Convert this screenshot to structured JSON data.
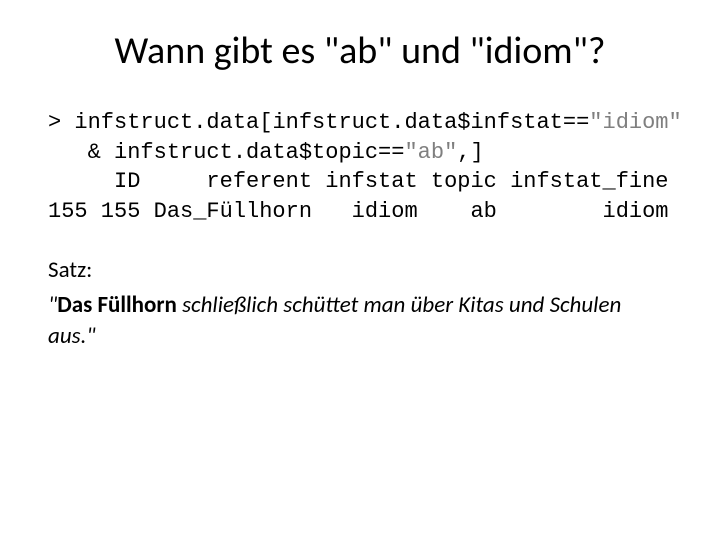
{
  "title": "Wann gibt es \"ab\" und \"idiom\"?",
  "code": {
    "prompt": ">",
    "line1a": "infstruct.data[infstruct.data$infstat==",
    "line1b": "\"idiom\"",
    "line2a": "   & infstruct.data$topic==",
    "line2b": "\"ab\"",
    "line2c": ",]",
    "header": "     ID     referent infstat topic infstat_fine",
    "row": "155 155 Das_Füllhorn   idiom    ab        idiom"
  },
  "body": {
    "label": "Satz:",
    "quote_prefix": "\"",
    "quote_bold": "Das Füllhorn",
    "quote_rest": " schließlich schüttet man über Kitas und Schulen aus.\""
  }
}
